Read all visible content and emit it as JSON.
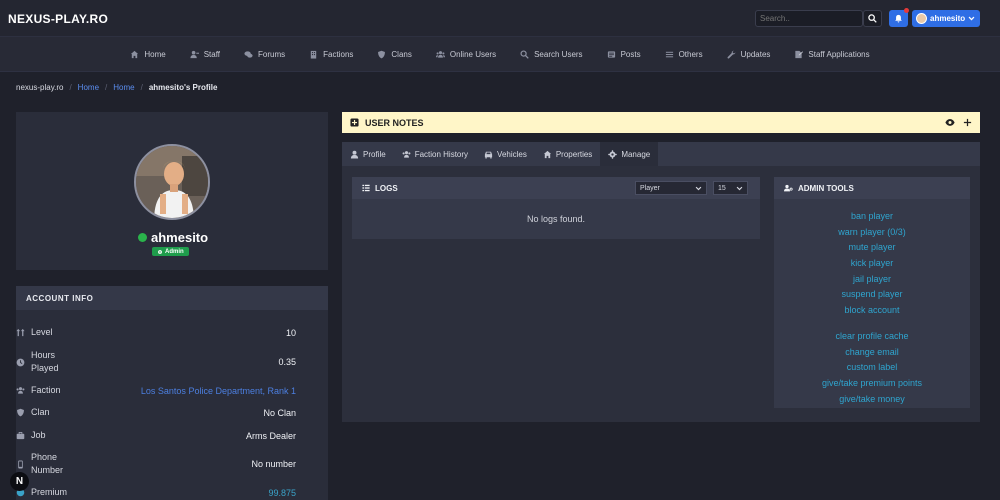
{
  "brand": "NEXUS-PLAY.RO",
  "search": {
    "placeholder": "Search.."
  },
  "user": {
    "name": "ahmesito"
  },
  "nav": [
    {
      "label": "Home",
      "icon": "home-icon"
    },
    {
      "label": "Staff",
      "icon": "staff-icon"
    },
    {
      "label": "Forums",
      "icon": "forums-icon"
    },
    {
      "label": "Factions",
      "icon": "factions-icon"
    },
    {
      "label": "Clans",
      "icon": "clans-icon"
    },
    {
      "label": "Online Users",
      "icon": "online-users-icon"
    },
    {
      "label": "Search Users",
      "icon": "search-users-icon"
    },
    {
      "label": "Posts",
      "icon": "posts-icon"
    },
    {
      "label": "Others",
      "icon": "others-icon"
    },
    {
      "label": "Updates",
      "icon": "updates-icon"
    },
    {
      "label": "Staff Applications",
      "icon": "staff-applications-icon"
    }
  ],
  "breadcrumb": {
    "site": "nexus-play.ro",
    "home1": "Home",
    "home2": "Home",
    "current": "ahmesito's Profile"
  },
  "profile": {
    "username": "ahmesito",
    "badge": "Admin"
  },
  "account": {
    "title": "ACCOUNT INFO",
    "rows": [
      {
        "label": "Level",
        "value": "10"
      },
      {
        "label": "Hours Played",
        "value": "0.35"
      },
      {
        "label": "Faction",
        "value": "Los Santos Police Department, Rank 1"
      },
      {
        "label": "Clan",
        "value": "No Clan"
      },
      {
        "label": "Job",
        "value": "Arms Dealer"
      },
      {
        "label": "Phone Number",
        "value": "No number"
      },
      {
        "label": "Premium",
        "value": "99.875"
      }
    ]
  },
  "notes": {
    "title": "USER NOTES"
  },
  "tabs": [
    {
      "label": "Profile"
    },
    {
      "label": "Faction History"
    },
    {
      "label": "Vehicles"
    },
    {
      "label": "Properties"
    },
    {
      "label": "Manage"
    }
  ],
  "logs": {
    "title": "LOGS",
    "filter": "Player",
    "count": "15",
    "empty": "No logs found."
  },
  "admin_tools": {
    "title": "ADMIN TOOLS",
    "links": [
      "ban player",
      "warn player (0/3)",
      "mute player",
      "kick player",
      "jail player",
      "suspend player",
      "block account",
      "clear profile cache",
      "change email",
      "custom label",
      "give/take premium points",
      "give/take money"
    ]
  },
  "colors": {
    "accent": "#2f6ee5",
    "link": "#2fa5cf",
    "online": "#2ab34b",
    "notes_bg": "#fff6c8"
  }
}
